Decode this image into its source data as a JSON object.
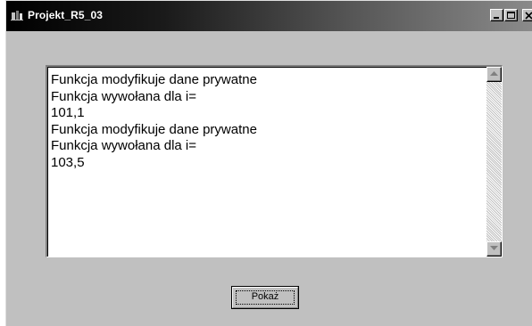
{
  "window": {
    "title": "Projekt_R5_03"
  },
  "memo": {
    "lines": [
      "Funkcja modyfikuje dane prywatne",
      "Funkcja wywołana dla i=",
      "101,1",
      "Funkcja modyfikuje dane prywatne",
      "Funkcja wywołana dla i=",
      "103,5"
    ]
  },
  "buttons": {
    "show_label": "Pokaż"
  },
  "icons": {
    "app": "delphi-app-icon",
    "minimize": "minimize-icon",
    "maximize": "maximize-icon",
    "close": "close-icon",
    "scroll_up": "arrow-up-icon",
    "scroll_down": "arrow-down-icon"
  }
}
